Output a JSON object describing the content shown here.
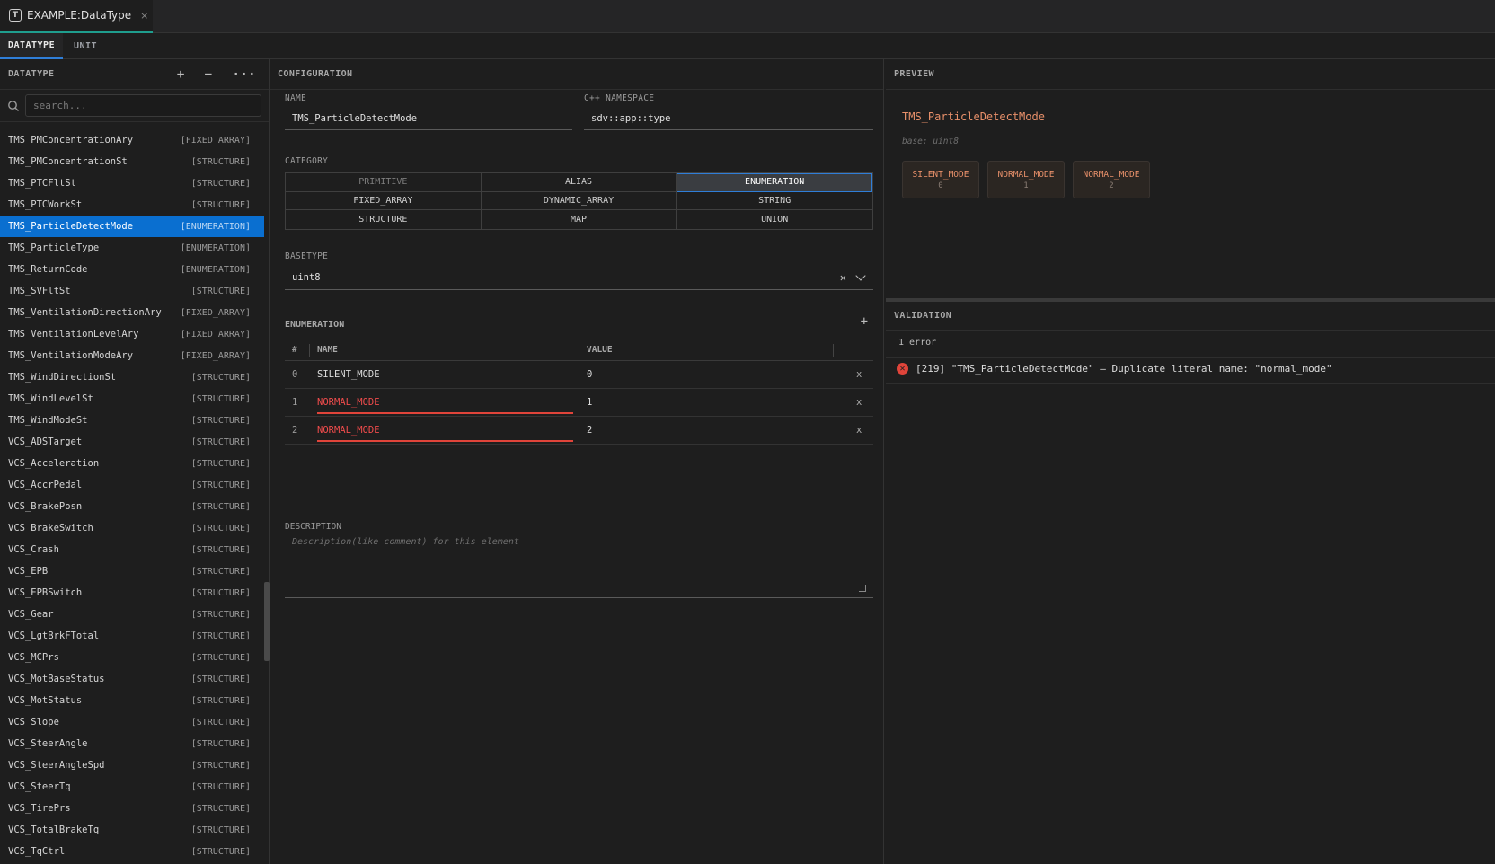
{
  "editor_tab": {
    "title": "EXAMPLE:DataType",
    "close": "×",
    "icon": "T"
  },
  "subtabs": [
    "DATATYPE",
    "UNIT"
  ],
  "left": {
    "title": "DATATYPE",
    "actions": {
      "add": "+",
      "remove": "−",
      "more": "···"
    },
    "search_placeholder": "search...",
    "items": [
      {
        "name": "TMS_PMConcentrationAry",
        "kind": "[FIXED_ARRAY]"
      },
      {
        "name": "TMS_PMConcentrationSt",
        "kind": "[STRUCTURE]"
      },
      {
        "name": "TMS_PTCFltSt",
        "kind": "[STRUCTURE]"
      },
      {
        "name": "TMS_PTCWorkSt",
        "kind": "[STRUCTURE]"
      },
      {
        "name": "TMS_ParticleDetectMode",
        "kind": "[ENUMERATION]"
      },
      {
        "name": "TMS_ParticleType",
        "kind": "[ENUMERATION]"
      },
      {
        "name": "TMS_ReturnCode",
        "kind": "[ENUMERATION]"
      },
      {
        "name": "TMS_SVFltSt",
        "kind": "[STRUCTURE]"
      },
      {
        "name": "TMS_VentilationDirectionAry",
        "kind": "[FIXED_ARRAY]"
      },
      {
        "name": "TMS_VentilationLevelAry",
        "kind": "[FIXED_ARRAY]"
      },
      {
        "name": "TMS_VentilationModeAry",
        "kind": "[FIXED_ARRAY]"
      },
      {
        "name": "TMS_WindDirectionSt",
        "kind": "[STRUCTURE]"
      },
      {
        "name": "TMS_WindLevelSt",
        "kind": "[STRUCTURE]"
      },
      {
        "name": "TMS_WindModeSt",
        "kind": "[STRUCTURE]"
      },
      {
        "name": "VCS_ADSTarget",
        "kind": "[STRUCTURE]"
      },
      {
        "name": "VCS_Acceleration",
        "kind": "[STRUCTURE]"
      },
      {
        "name": "VCS_AccrPedal",
        "kind": "[STRUCTURE]"
      },
      {
        "name": "VCS_BrakePosn",
        "kind": "[STRUCTURE]"
      },
      {
        "name": "VCS_BrakeSwitch",
        "kind": "[STRUCTURE]"
      },
      {
        "name": "VCS_Crash",
        "kind": "[STRUCTURE]"
      },
      {
        "name": "VCS_EPB",
        "kind": "[STRUCTURE]"
      },
      {
        "name": "VCS_EPBSwitch",
        "kind": "[STRUCTURE]"
      },
      {
        "name": "VCS_Gear",
        "kind": "[STRUCTURE]"
      },
      {
        "name": "VCS_LgtBrkFTotal",
        "kind": "[STRUCTURE]"
      },
      {
        "name": "VCS_MCPrs",
        "kind": "[STRUCTURE]"
      },
      {
        "name": "VCS_MotBaseStatus",
        "kind": "[STRUCTURE]"
      },
      {
        "name": "VCS_MotStatus",
        "kind": "[STRUCTURE]"
      },
      {
        "name": "VCS_Slope",
        "kind": "[STRUCTURE]"
      },
      {
        "name": "VCS_SteerAngle",
        "kind": "[STRUCTURE]"
      },
      {
        "name": "VCS_SteerAngleSpd",
        "kind": "[STRUCTURE]"
      },
      {
        "name": "VCS_SteerTq",
        "kind": "[STRUCTURE]"
      },
      {
        "name": "VCS_TirePrs",
        "kind": "[STRUCTURE]"
      },
      {
        "name": "VCS_TotalBrakeTq",
        "kind": "[STRUCTURE]"
      },
      {
        "name": "VCS_TqCtrl",
        "kind": "[STRUCTURE]"
      }
    ],
    "selected": "TMS_ParticleDetectMode"
  },
  "config": {
    "title": "CONFIGURATION",
    "name_label": "NAME",
    "name_value": "TMS_ParticleDetectMode",
    "ns_label": "C++ NAMESPACE",
    "ns_value": "sdv::app::type",
    "category_label": "CATEGORY",
    "categories": [
      "PRIMITIVE",
      "ALIAS",
      "ENUMERATION",
      "FIXED_ARRAY",
      "DYNAMIC_ARRAY",
      "STRING",
      "STRUCTURE",
      "MAP",
      "UNION"
    ],
    "category_selected": "ENUMERATION",
    "basetype_label": "BASETYPE",
    "basetype_value": "uint8",
    "enum_label": "ENUMERATION",
    "enum_add": "+",
    "enum_headers": {
      "idx": "#",
      "name": "NAME",
      "value": "VALUE"
    },
    "enum_rows": [
      {
        "idx": "0",
        "name": "SILENT_MODE",
        "value": "0",
        "dup": false
      },
      {
        "idx": "1",
        "name": "NORMAL_MODE",
        "value": "1",
        "dup": true
      },
      {
        "idx": "2",
        "name": "NORMAL_MODE",
        "value": "2",
        "dup": true
      }
    ],
    "delete_label": "x",
    "desc_label": "DESCRIPTION",
    "desc_placeholder": "Description(like comment) for this element"
  },
  "preview": {
    "title": "PREVIEW",
    "name": "TMS_ParticleDetectMode",
    "base": "base: uint8",
    "chips": [
      {
        "name": "SILENT_MODE",
        "value": "0"
      },
      {
        "name": "NORMAL_MODE",
        "value": "1"
      },
      {
        "name": "NORMAL_MODE",
        "value": "2"
      }
    ]
  },
  "validation": {
    "title": "VALIDATION",
    "count": "1 error",
    "errors": [
      "[219] \"TMS_ParticleDetectMode\" — Duplicate literal name: \"normal_mode\""
    ]
  },
  "colors": {
    "accent": "#0a6fd0",
    "error": "#e0443a",
    "preview_name": "#e8906a",
    "tab_underline": "#1f9e8e"
  }
}
